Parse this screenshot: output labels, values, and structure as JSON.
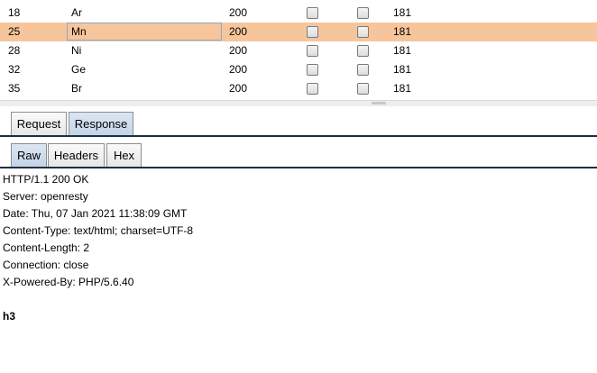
{
  "results": [
    {
      "request": "18",
      "payload": "Ar",
      "status": "200",
      "length": "181",
      "selected": false
    },
    {
      "request": "25",
      "payload": "Mn",
      "status": "200",
      "length": "181",
      "selected": true
    },
    {
      "request": "28",
      "payload": "Ni",
      "status": "200",
      "length": "181",
      "selected": false
    },
    {
      "request": "32",
      "payload": "Ge",
      "status": "200",
      "length": "181",
      "selected": false
    },
    {
      "request": "35",
      "payload": "Br",
      "status": "200",
      "length": "181",
      "selected": false
    }
  ],
  "tabs": {
    "request": "Request",
    "response": "Response",
    "raw": "Raw",
    "headers": "Headers",
    "hex": "Hex"
  },
  "response": {
    "lines": [
      "HTTP/1.1 200 OK",
      "Server: openresty",
      "Date: Thu, 07 Jan 2021 11:38:09 GMT",
      "Content-Type: text/html; charset=UTF-8",
      "Content-Length: 2",
      "Connection: close",
      "X-Powered-By: PHP/5.6.40"
    ],
    "body": "h3"
  },
  "colors": {
    "selected_row": "#f7c59b",
    "active_tab": "#c4d4e8",
    "tab_line": "#1e2e44"
  }
}
